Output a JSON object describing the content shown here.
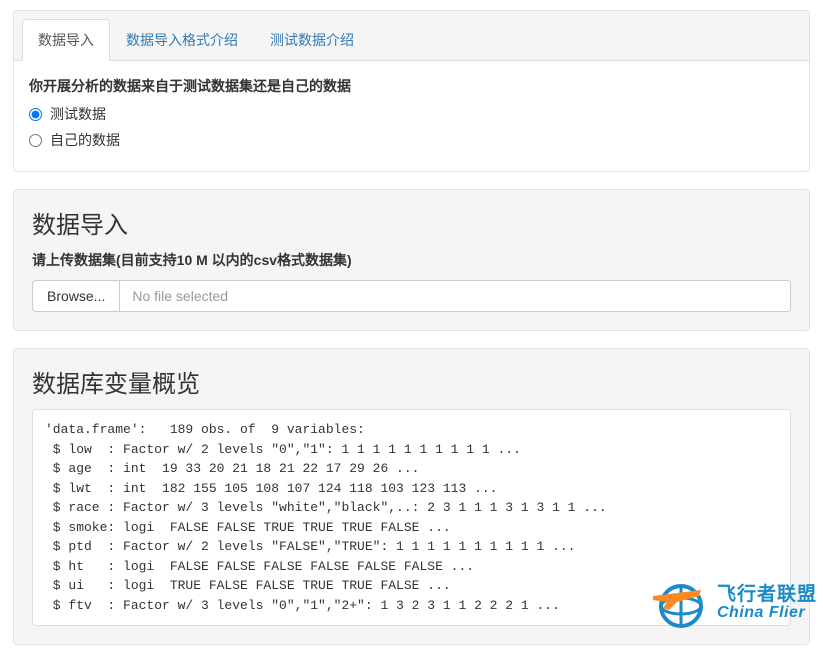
{
  "tabs": {
    "items": [
      {
        "label": "数据导入",
        "active": true
      },
      {
        "label": "数据导入格式介绍",
        "active": false
      },
      {
        "label": "测试数据介绍",
        "active": false
      }
    ]
  },
  "dataSource": {
    "question": "你开展分析的数据来自于测试数据集还是自己的数据",
    "options": [
      {
        "label": "测试数据",
        "checked": true
      },
      {
        "label": "自己的数据",
        "checked": false
      }
    ]
  },
  "import": {
    "title": "数据导入",
    "subtitle": "请上传数据集(目前支持10 M 以内的csv格式数据集)",
    "browseLabel": "Browse...",
    "filePlaceholder": "No file selected"
  },
  "overview": {
    "title": "数据库变量概览",
    "code": "'data.frame':   189 obs. of  9 variables:\n $ low  : Factor w/ 2 levels \"0\",\"1\": 1 1 1 1 1 1 1 1 1 1 ...\n $ age  : int  19 33 20 21 18 21 22 17 29 26 ...\n $ lwt  : int  182 155 105 108 107 124 118 103 123 113 ...\n $ race : Factor w/ 3 levels \"white\",\"black\",..: 2 3 1 1 1 3 1 3 1 1 ...\n $ smoke: logi  FALSE FALSE TRUE TRUE TRUE FALSE ...\n $ ptd  : Factor w/ 2 levels \"FALSE\",\"TRUE\": 1 1 1 1 1 1 1 1 1 1 ...\n $ ht   : logi  FALSE FALSE FALSE FALSE FALSE FALSE ...\n $ ui   : logi  TRUE FALSE FALSE TRUE TRUE FALSE ...\n $ ftv  : Factor w/ 3 levels \"0\",\"1\",\"2+\": 1 3 2 3 1 1 2 2 2 1 ..."
  },
  "watermark": {
    "top": "飞行者联盟",
    "bottom": "China Flier"
  }
}
